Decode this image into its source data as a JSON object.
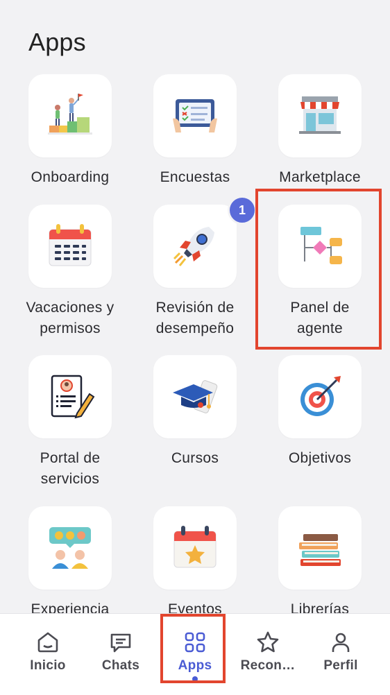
{
  "page": {
    "title": "Apps"
  },
  "apps": [
    {
      "label_1": "Onboarding",
      "label_2": "",
      "icon": "onboarding-icon"
    },
    {
      "label_1": "Encuestas",
      "label_2": "",
      "icon": "survey-tablet-icon"
    },
    {
      "label_1": "Marketplace",
      "label_2": "",
      "icon": "store-icon"
    },
    {
      "label_1": "Vacaciones y",
      "label_2": "permisos",
      "icon": "calendar-icon"
    },
    {
      "label_1": "Revisión de",
      "label_2": "desempeño",
      "icon": "rocket-icon",
      "badge": "1"
    },
    {
      "label_1": "Panel de",
      "label_2": "agente",
      "icon": "flowchart-icon"
    },
    {
      "label_1": "Portal de",
      "label_2": "servicios",
      "icon": "profile-document-icon"
    },
    {
      "label_1": "Cursos",
      "label_2": "",
      "icon": "graduation-cap-icon"
    },
    {
      "label_1": "Objetivos",
      "label_2": "",
      "icon": "target-icon"
    },
    {
      "label_1": "Experiencia",
      "label_2": "",
      "icon": "feedback-faces-icon"
    },
    {
      "label_1": "Eventos",
      "label_2": "",
      "icon": "event-calendar-icon"
    },
    {
      "label_1": "Librerías",
      "label_2": "",
      "icon": "books-icon"
    }
  ],
  "tabbar": {
    "items": [
      {
        "label": "Inicio",
        "icon": "home-icon"
      },
      {
        "label": "Chats",
        "icon": "chat-icon"
      },
      {
        "label": "Apps",
        "icon": "grid-icon",
        "active": true
      },
      {
        "label": "Recon…",
        "icon": "star-icon"
      },
      {
        "label": "Perfil",
        "icon": "user-icon"
      }
    ]
  },
  "colors": {
    "accent": "#4a5bd4",
    "highlight": "#e2452e",
    "badge": "#5a6bd9"
  }
}
